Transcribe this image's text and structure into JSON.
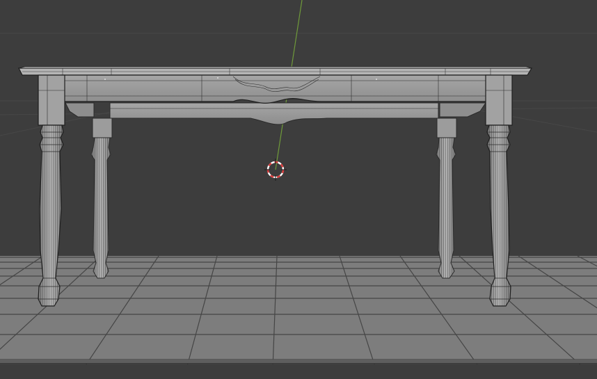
{
  "viewport": {
    "type": "3d-viewport",
    "shading": "solid-wireframe",
    "colors": {
      "background": "#3d3d3d",
      "grid_floor": "#7f7f7f",
      "grid_line": "#4a4a4a",
      "y_axis": "#6f9a3a",
      "cursor_red": "#d83a3a",
      "cursor_white": "#ffffff",
      "mesh_fill": "#9a9a9a",
      "mesh_wire": "#2a2a2a"
    },
    "scene_objects": [
      "table-mesh",
      "3d-cursor",
      "floor-grid",
      "y-axis-line"
    ]
  }
}
